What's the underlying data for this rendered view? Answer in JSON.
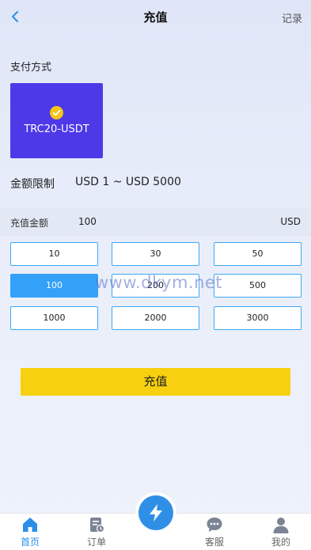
{
  "header": {
    "title": "充值",
    "record_label": "记录"
  },
  "payment": {
    "section_label": "支付方式",
    "method_label": "TRC20-USDT"
  },
  "limit": {
    "label": "金额限制",
    "value": "USD 1 ~ USD 5000"
  },
  "amount": {
    "label": "充值金额",
    "value": "100",
    "unit": "USD"
  },
  "amount_options": [
    "10",
    "30",
    "50",
    "100",
    "200",
    "500",
    "1000",
    "2000",
    "3000"
  ],
  "selected_amount": "100",
  "watermark": "www.dkym.net",
  "submit_label": "充值",
  "tabbar": {
    "items": [
      {
        "label": "首页",
        "icon": "home-icon"
      },
      {
        "label": "订单",
        "icon": "order-icon"
      },
      {
        "label": "",
        "icon": "lightning-icon"
      },
      {
        "label": "客服",
        "icon": "chat-icon"
      },
      {
        "label": "我的",
        "icon": "user-icon"
      }
    ]
  },
  "colors": {
    "primary": "#33a1f7",
    "card": "#4d39e8",
    "submit": "#f7d00f",
    "check": "#f5c518"
  }
}
